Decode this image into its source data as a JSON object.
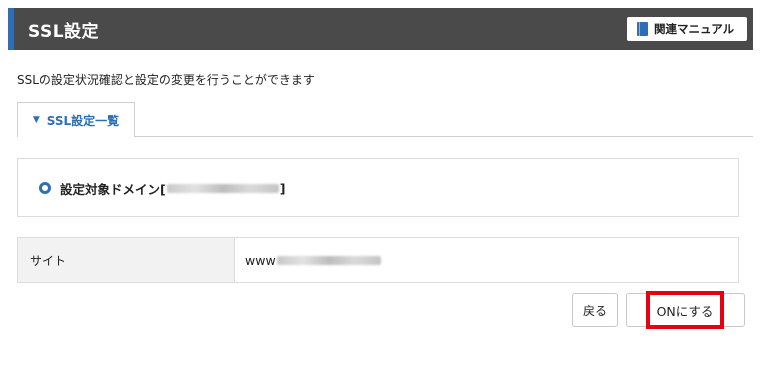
{
  "header": {
    "title": "SSL設定",
    "manual_button": "関連マニュアル",
    "accent_color": "#2f6eb5",
    "bar_color": "#4a4a4a"
  },
  "description": "SSLの設定状況確認と設定の変更を行うことができます",
  "tab": {
    "label": "SSL設定一覧",
    "icon": "chevron-down-icon"
  },
  "domain": {
    "label_prefix": "設定対象ドメイン[",
    "label_suffix": "]"
  },
  "site_table": {
    "header": "サイト",
    "value_prefix": "www"
  },
  "buttons": {
    "back": "戻る",
    "turn_on": "ONにする",
    "highlight_color": "#e60012"
  }
}
